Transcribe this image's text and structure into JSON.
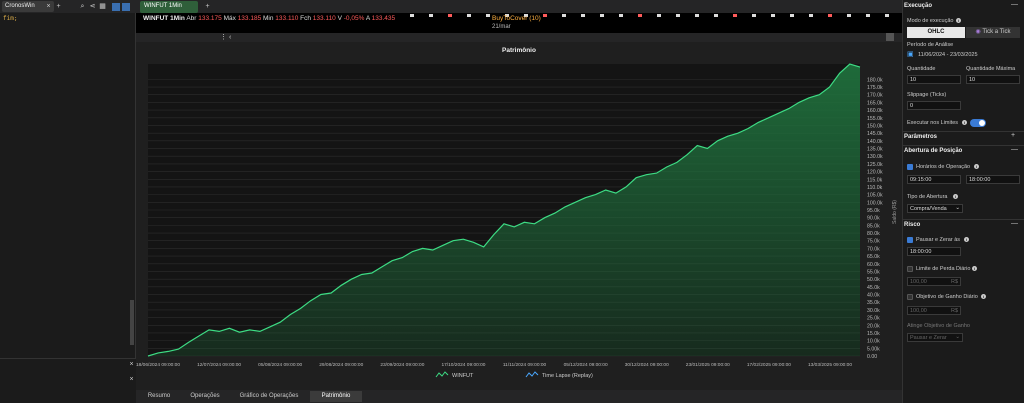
{
  "left_panel": {
    "tab_label": "CronosWin",
    "code_text": "fim;"
  },
  "chart_window": {
    "tab_label": "WINFUT 1Min",
    "symbol": "WINFUT 1Min",
    "abr_label": "Abr",
    "abr_value": "133.175",
    "max_label": "Máx",
    "max_value": "133.185",
    "min_label": "Min",
    "min_value": "133.110",
    "fch_label": "Fch",
    "fch_value": "133.110",
    "v_label": "V",
    "v_value": "-0,05%",
    "a_label": "A",
    "a_value": "133.435",
    "signal_label": "BuyToCover (10)",
    "date_label": "21/mar"
  },
  "bottom_tabs": [
    "Resumo",
    "Operações",
    "Gráfico de Operações",
    "Patrimônio"
  ],
  "right_panel": {
    "execucao_title": "Execução",
    "modo_label": "Modo de execução",
    "modo_options": [
      "OHLC",
      "Tick a Tick"
    ],
    "periodo_label": "Período de Análise",
    "periodo_value": "11/06/2024 - 23/03/2025",
    "qtd_label": "Quantidade",
    "qtd_value": "10",
    "qtd_max_label": "Quantidade Máxima",
    "qtd_max_value": "10",
    "slippage_label": "Slippage (Ticks)",
    "slippage_value": "0",
    "executar_label": "Executar nos Limites",
    "parametros_title": "Parâmetros",
    "abertura_title": "Abertura de Posição",
    "horarios_label": "Horários de Operação",
    "hora_inicio": "09:15:00",
    "hora_fim": "18:00:00",
    "tipo_label": "Tipo de Abertura",
    "tipo_value": "Compra/Venda",
    "risco_title": "Risco",
    "pausar_label": "Pausar e Zerar às",
    "pausar_value": "18:00:00",
    "limite_label": "Limite de Perda Diário",
    "limite_value": "100,00",
    "limite_unit": "R$",
    "objetivo_label": "Objetivo de Ganho Diário",
    "objetivo_value": "100,00",
    "objetivo_unit": "R$",
    "atinge_label": "Atinge Objetivo de Ganho",
    "atinge_value": "Pausar e Zerar"
  },
  "chart_data": {
    "type": "area",
    "title": "Patrimônio",
    "ylabel": "Saldo (R$)",
    "ylim": [
      0,
      190000
    ],
    "yticks": [
      "0.00",
      "5.00k",
      "10.0k",
      "15.0k",
      "20.0k",
      "25.0k",
      "30.0k",
      "35.0k",
      "40.0k",
      "45.0k",
      "50.0k",
      "55.0k",
      "60.0k",
      "65.0k",
      "70.0k",
      "75.0k",
      "80.0k",
      "85.0k",
      "90.0k",
      "95.0k",
      "100.0k",
      "105.0k",
      "110.0k",
      "115.0k",
      "120.0k",
      "125.0k",
      "130.0k",
      "135.0k",
      "140.0k",
      "145.0k",
      "150.0k",
      "155.0k",
      "160.0k",
      "165.0k",
      "170.0k",
      "175.0k",
      "180.0k"
    ],
    "xticks": [
      "18/06/2024 09:00:00",
      "12/07/2024 09:00:00",
      "05/08/2024 09:00:00",
      "29/08/2024 09:00:00",
      "23/09/2024 09:00:00",
      "17/10/2024 09:00:00",
      "11/11/2024 09:00:00",
      "05/12/2024 09:00:00",
      "30/12/2024 09:00:00",
      "23/01/2025 09:00:00",
      "17/02/2025 09:00:00",
      "13/03/2025 09:00:00"
    ],
    "x_range": [
      "11/06/2024",
      "23/03/2025"
    ],
    "series": [
      {
        "name": "WINFUT",
        "color": "#3ddc84"
      },
      {
        "name": "Time Lapse (Replay)",
        "color": "#4aa8ff"
      }
    ],
    "values": [
      0,
      2000,
      3000,
      4500,
      9000,
      13000,
      17000,
      16000,
      18000,
      15500,
      17000,
      16000,
      19000,
      22000,
      27000,
      31000,
      36000,
      40000,
      41000,
      46000,
      50000,
      53000,
      54000,
      58000,
      62000,
      64000,
      68000,
      70000,
      69000,
      72000,
      75000,
      76000,
      74000,
      71000,
      79000,
      86000,
      84000,
      87000,
      86000,
      90000,
      93000,
      97000,
      100000,
      103000,
      105000,
      108000,
      106000,
      110000,
      116000,
      118000,
      119000,
      123000,
      126000,
      131000,
      137000,
      135000,
      140000,
      143000,
      145000,
      148000,
      152000,
      155000,
      158000,
      161000,
      165000,
      168000,
      170000,
      175000,
      184000,
      190000,
      188000
    ],
    "legend_position": "bottom",
    "grid": true,
    "fill_color": "#1f6f3c"
  }
}
